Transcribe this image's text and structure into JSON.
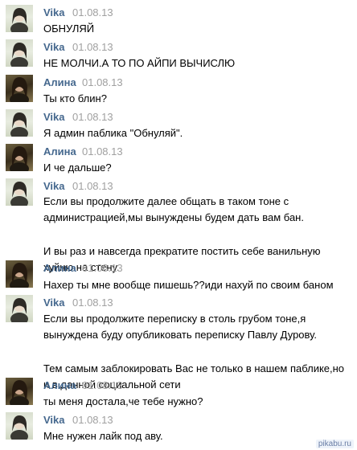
{
  "messages": [
    {
      "author": "Vika",
      "date": "01.08.13",
      "avatar": "vika",
      "paragraphs": [
        "ОБНУЛЯЙ"
      ]
    },
    {
      "author": "Vika",
      "date": "01.08.13",
      "avatar": "vika",
      "paragraphs": [
        "НЕ МОЛЧИ.А ТО ПО АЙПИ ВЫЧИСЛЮ"
      ]
    },
    {
      "author": "Алина",
      "date": "01.08.13",
      "avatar": "alina",
      "paragraphs": [
        "Ты кто блин?"
      ]
    },
    {
      "author": "Vika",
      "date": "01.08.13",
      "avatar": "vika",
      "paragraphs": [
        "Я админ паблика \"Обнуляй\"."
      ]
    },
    {
      "author": "Алина",
      "date": "01.08.13",
      "avatar": "alina",
      "paragraphs": [
        "И че дальше?"
      ]
    },
    {
      "author": "Vika",
      "date": "01.08.13",
      "avatar": "vika",
      "paragraphs": [
        "Если вы продолжите далее общать в таком тоне с администрацией,мы вынуждены будем дать вам бан.",
        "И вы раз и навсегда прекратите постить себе ванильную хуйню на стену."
      ]
    },
    {
      "author": "Алина",
      "date": "01.08.13",
      "avatar": "alina",
      "paragraphs": [
        "Нахер ты мне вообще пишешь??иди нахуй по своим баном"
      ]
    },
    {
      "author": "Vika",
      "date": "01.08.13",
      "avatar": "vika",
      "paragraphs": [
        "Если вы продолжите переписку в столь грубом тоне,я вынуждена буду опубликовать переписку Павлу Дурову.",
        "Тем самым заблокировать Вас не только в нашем паблике,но и в данной социальной сети"
      ]
    },
    {
      "author": "Алина",
      "date": "01.08.13",
      "avatar": "alina",
      "paragraphs": [
        "ты меня достала,че тебе нужно?"
      ]
    },
    {
      "author": "Vika",
      "date": "01.08.13",
      "avatar": "vika",
      "paragraphs": [
        "Мне нужен лайк под аву."
      ]
    }
  ],
  "watermark": "pikabu.ru",
  "colors": {
    "author": "#45688e",
    "date": "#a0a0a0",
    "text": "#000000"
  }
}
